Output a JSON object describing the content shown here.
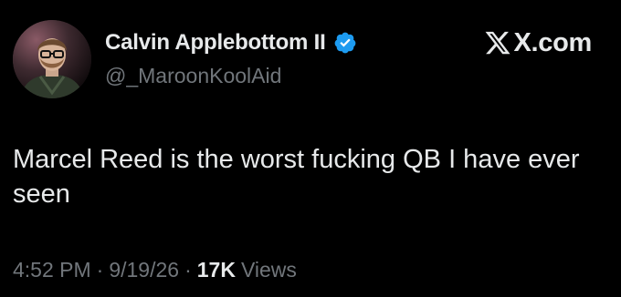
{
  "brand": {
    "name": "X.com",
    "icon": "x-logo-icon"
  },
  "author": {
    "display_name": "Calvin Applebottom II",
    "handle": "@_MaroonKoolAid",
    "verified": true,
    "verified_color": "#1d9bf0",
    "avatar_icon": "avatar"
  },
  "tweet": {
    "text": "Marcel Reed is the worst fucking QB I have ever seen",
    "time": "4:52 PM",
    "date": "9/19/26",
    "separator": "·",
    "views_count": "17K",
    "views_label": "Views"
  },
  "colors": {
    "background": "#000000",
    "primary_text": "#e7e9ea",
    "secondary_text": "#71767b",
    "accent": "#1d9bf0"
  }
}
